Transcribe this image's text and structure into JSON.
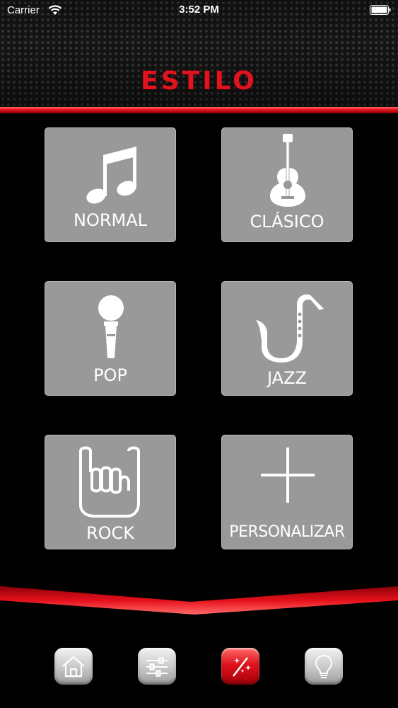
{
  "status_bar": {
    "carrier": "Carrier",
    "time": "3:52 PM"
  },
  "header": {
    "title": "ESTILO"
  },
  "styles": [
    {
      "label": "NORMAL",
      "icon": "music-note-icon"
    },
    {
      "label": "CLÁSICO",
      "icon": "guitar-icon"
    },
    {
      "label": "POP",
      "icon": "microphone-icon"
    },
    {
      "label": "JAZZ",
      "icon": "saxophone-icon"
    },
    {
      "label": "ROCK",
      "icon": "rock-hand-icon"
    },
    {
      "label": "PERSONALIZAR",
      "icon": "plus-icon"
    }
  ],
  "tabbar": {
    "items": [
      {
        "name": "home",
        "icon": "home-icon",
        "active": false
      },
      {
        "name": "equalizer",
        "icon": "sliders-icon",
        "active": false
      },
      {
        "name": "style",
        "icon": "magic-wand-icon",
        "active": true
      },
      {
        "name": "light",
        "icon": "light-bulb-icon",
        "active": false
      }
    ]
  },
  "colors": {
    "accent": "#e5101b",
    "tile": "#999999",
    "background": "#000000"
  }
}
